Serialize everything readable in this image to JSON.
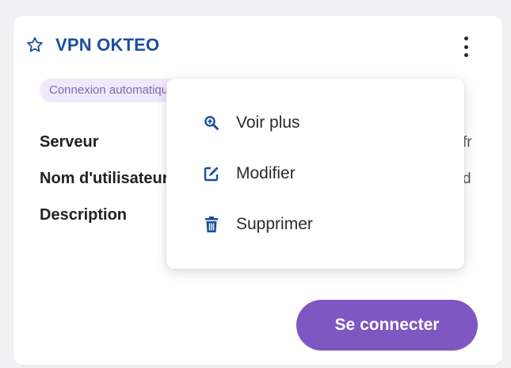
{
  "card": {
    "title": "VPN OKTEO",
    "badge": "Connexion automatique",
    "fields": [
      {
        "label": "Serveur",
        "value": "fr"
      },
      {
        "label": "Nom d'utilisateur",
        "value": "d"
      },
      {
        "label": "Description",
        "value": ""
      }
    ],
    "connect_label": "Se connecter"
  },
  "menu": {
    "items": [
      {
        "label": "Voir plus",
        "icon": "zoom-in-icon"
      },
      {
        "label": "Modifier",
        "icon": "edit-icon"
      },
      {
        "label": "Supprimer",
        "icon": "trash-icon"
      }
    ]
  },
  "colors": {
    "title": "#1a4f9c",
    "accent": "#7e57c2",
    "badge_bg": "#efe9fb",
    "badge_text": "#7d6ab0",
    "menu_icon": "#1a4f9c"
  }
}
